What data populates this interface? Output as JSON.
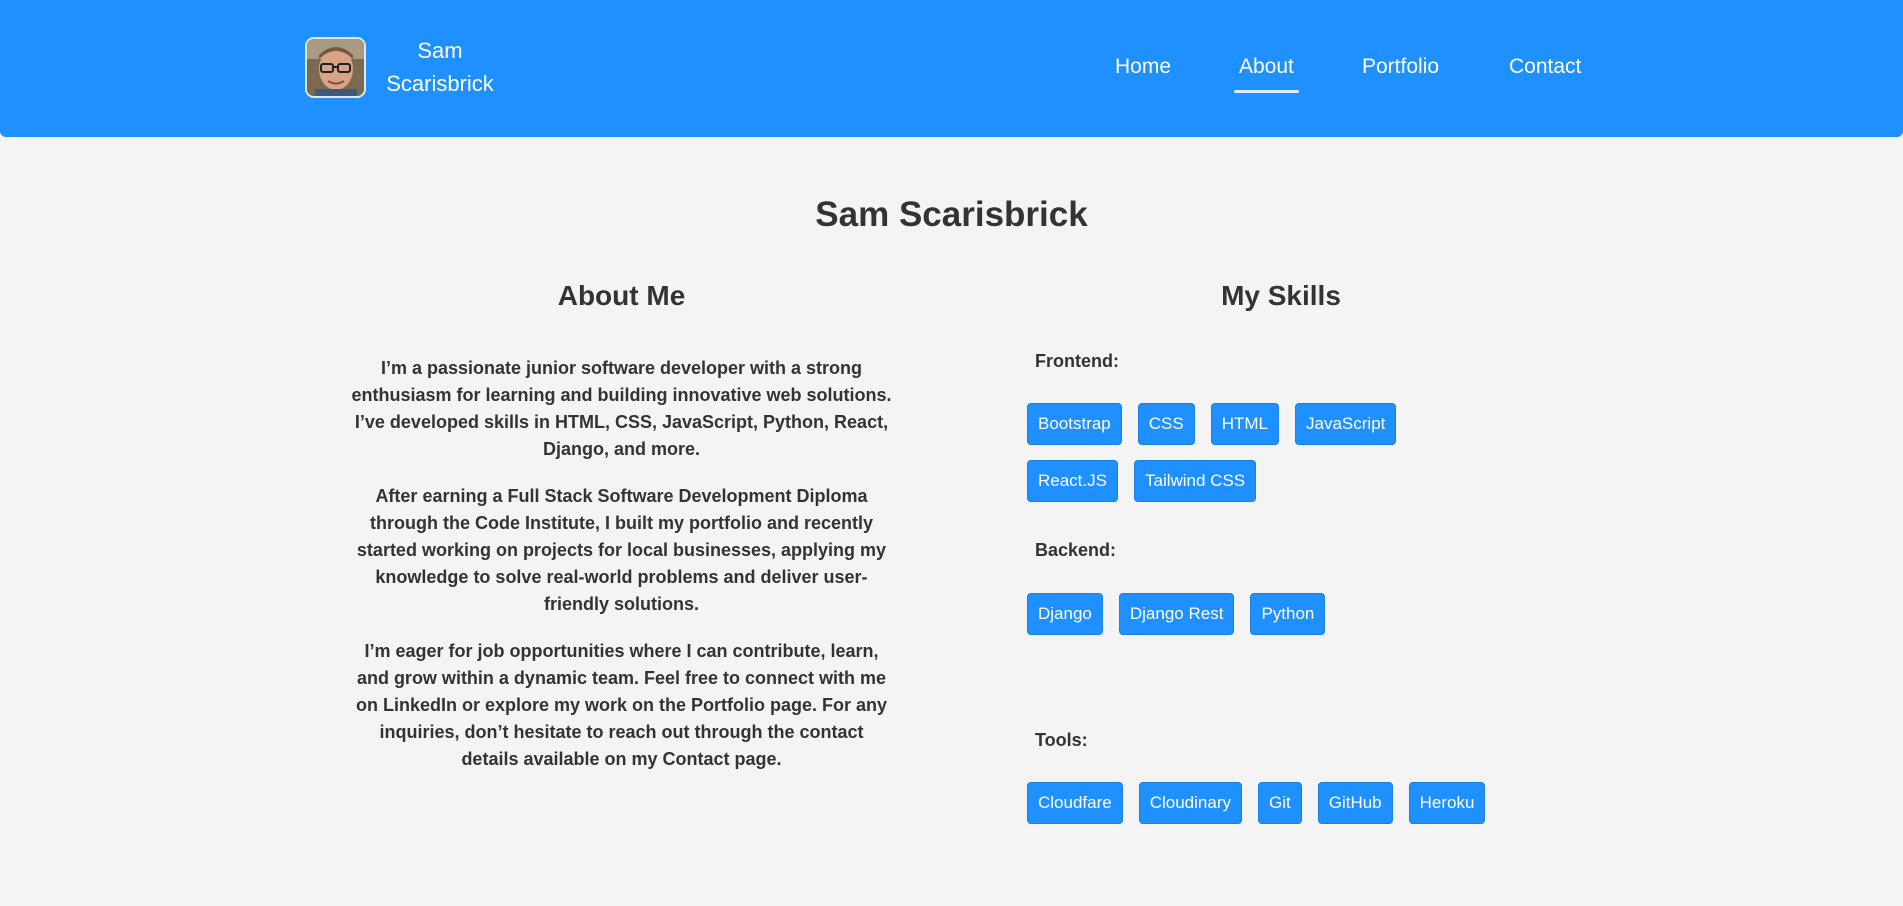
{
  "header": {
    "brand_line1": "Sam",
    "brand_line2": "Scarisbrick",
    "nav": [
      {
        "label": "Home",
        "active": false
      },
      {
        "label": "About",
        "active": true
      },
      {
        "label": "Portfolio",
        "active": false
      },
      {
        "label": "Contact",
        "active": false
      }
    ],
    "accent_color": "#1e90ff"
  },
  "main": {
    "title": "Sam Scarisbrick",
    "about": {
      "heading": "About Me",
      "paragraphs": [
        "I’m a passionate junior software developer with a strong enthusiasm for learning and building innovative web solutions. I’ve developed skills in HTML, CSS, JavaScript, Python, React, Django, and more.",
        "After earning a Full Stack Software Development Diploma through the Code Institute, I built my portfolio and recently started working on projects for local businesses, applying my knowledge to solve real-world problems and deliver user-friendly solutions.",
        "I’m eager for job opportunities where I can contribute, learn, and grow within a dynamic team. Feel free to connect with me on LinkedIn or explore my work on the Portfolio page. For any inquiries, don’t hesitate to reach out through the contact details available on my Contact page."
      ]
    },
    "skills": {
      "heading": "My Skills",
      "groups": [
        {
          "label": "Frontend:",
          "items": [
            "Bootstrap",
            "CSS",
            "HTML",
            "JavaScript",
            "React.JS",
            "Tailwind CSS"
          ]
        },
        {
          "label": "Backend:",
          "items": [
            "Django",
            "Django Rest",
            "Python"
          ]
        },
        {
          "label": "Tools:",
          "items": [
            "Cloudfare",
            "Cloudinary",
            "Git",
            "GitHub",
            "Heroku"
          ]
        }
      ]
    }
  }
}
